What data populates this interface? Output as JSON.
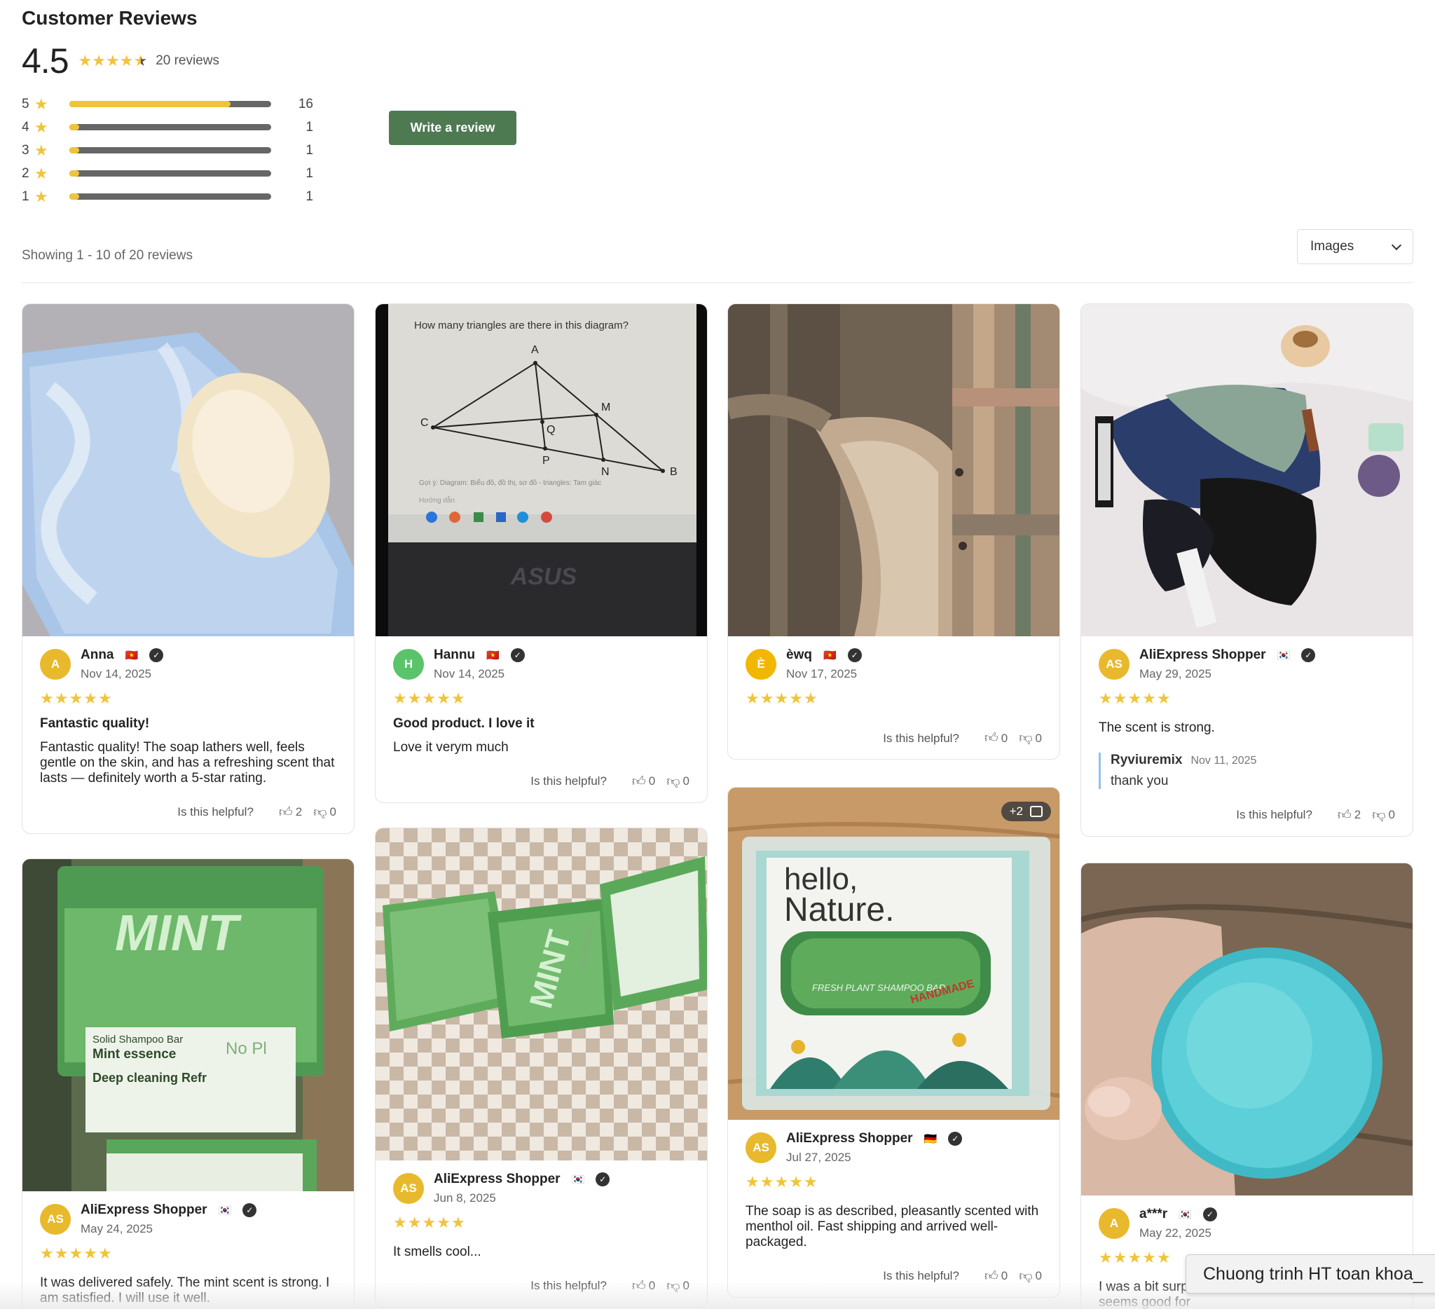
{
  "header": {
    "title": "Customer Reviews"
  },
  "summary": {
    "average": "4.5",
    "average_value": 4.5,
    "review_count_label": "20 reviews",
    "star_color": "#f0c43a"
  },
  "distribution": [
    {
      "stars": "5",
      "count": "16",
      "fraction": 0.8
    },
    {
      "stars": "4",
      "count": "1",
      "fraction": 0.05
    },
    {
      "stars": "3",
      "count": "1",
      "fraction": 0.05
    },
    {
      "stars": "2",
      "count": "1",
      "fraction": 0.05
    },
    {
      "stars": "1",
      "count": "1",
      "fraction": 0.05
    }
  ],
  "actions": {
    "write_review": "Write a review",
    "button_color": "#4e7a52"
  },
  "listing": {
    "showing": "Showing 1 - 10 of 20 reviews",
    "filter_value": "Images"
  },
  "helpful_label": "Is this helpful?",
  "reviews": [
    {
      "avatar": "A",
      "avatar_color": "#e8b92c",
      "name": "Anna",
      "flag": "🇻🇳",
      "date": "Nov 14, 2025",
      "rating": 5,
      "title": "Fantastic quality!",
      "text": "Fantastic quality! The soap lathers well, feels gentle on the skin, and has a refreshing scent that lasts — definitely worth a 5-star rating.",
      "likes": "2",
      "dislikes": "0",
      "image": "soap-on-towel"
    },
    {
      "avatar": "H",
      "avatar_color": "#5bc46a",
      "name": "Hannu",
      "flag": "🇻🇳",
      "date": "Nov 14, 2025",
      "rating": 5,
      "title": "Good product. I love it",
      "text": "Love it verym much",
      "likes": "0",
      "dislikes": "0",
      "image": "triangle-diagram-screen",
      "screen_text": {
        "question": "How many triangles are there in this diagram?",
        "labels": [
          "A",
          "M",
          "C",
          "Q",
          "P",
          "N",
          "B"
        ],
        "hint": "Gợi ý: Diagram: Biểu đồ, đồ thị, sơ đồ - triangles: Tam giác",
        "hint2": "Hướng dẫn",
        "brand": "ASUS"
      }
    },
    {
      "avatar": "È",
      "avatar_color": "#f2b705",
      "name": "èwq",
      "flag": "🇻🇳",
      "date": "Nov 17, 2025",
      "rating": 5,
      "title": "",
      "text": "",
      "likes": "0",
      "dislikes": "0",
      "image": "plaid-shirt"
    },
    {
      "avatar": "AS",
      "avatar_color": "#e8b92c",
      "name": "AliExpress Shopper",
      "flag": "🇰🇷",
      "date": "May 29, 2025",
      "rating": 5,
      "title": "",
      "text": "The scent is strong.",
      "reply": {
        "name": "Ryviuremix",
        "date": "Nov 11, 2025",
        "text": "thank you"
      },
      "likes": "2",
      "dislikes": "0",
      "image": "underwear-and-items"
    },
    {
      "avatar": "AS",
      "avatar_color": "#e8b92c",
      "name": "AliExpress Shopper",
      "flag": "🇰🇷",
      "date": "May 24, 2025",
      "rating": 5,
      "title": "",
      "text": "It was delivered safely. The mint scent is strong. I am satisfied. I will use it well.",
      "likes": "",
      "dislikes": "",
      "image": "mint-shampoo-package",
      "package_text": {
        "brand": "MINT",
        "line1": "Solid Shampoo Bar",
        "line2": "Mint essence",
        "line3": "Deep cleaning Refr",
        "badge": "No Pl"
      }
    },
    {
      "avatar": "AS",
      "avatar_color": "#e8b92c",
      "name": "AliExpress Shopper",
      "flag": "🇰🇷",
      "date": "Jun 8, 2025",
      "rating": 5,
      "title": "",
      "text": "It smells cool...",
      "likes": "0",
      "dislikes": "0",
      "image": "mint-bars-on-checkered-cloth",
      "package_text": {
        "brand": "MINT",
        "badge": "No Plastic"
      }
    },
    {
      "avatar": "AS",
      "avatar_color": "#e8b92c",
      "name": "AliExpress Shopper",
      "flag": "🇩🇪",
      "date": "Jul 27, 2025",
      "rating": 5,
      "title": "",
      "text": "The soap is as described, pleasantly scented with menthol oil. Fast shipping and arrived well-packaged.",
      "likes": "0",
      "dislikes": "0",
      "image": "hello-nature-box",
      "extra_images": "+2",
      "package_text": {
        "line1": "hello,",
        "line2": "Nature.",
        "line3": "FRESH PLANT SHAMPOO BAR",
        "badge": "HANDMADE"
      }
    },
    {
      "avatar": "A",
      "avatar_color": "#e8b92c",
      "name": "a***r",
      "flag": "🇰🇷",
      "date": "May 22, 2025",
      "rating": 5,
      "title": "",
      "text": "I was a bit surp refreshing than I expected. It seems good for",
      "likes": "",
      "dislikes": "",
      "image": "blue-shampoo-bar-in-hand"
    }
  ],
  "toast": {
    "text": "Chuong trinh HT toan khoa_"
  }
}
